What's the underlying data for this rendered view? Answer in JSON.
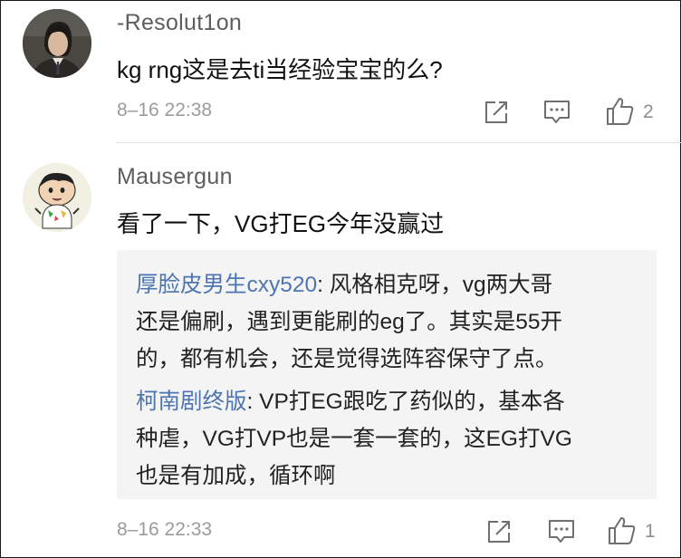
{
  "comments": [
    {
      "username": "-Resolut1on",
      "text": "kg rng这是去ti当经验宝宝的么?",
      "time": "8–16 22:38",
      "likes": "2",
      "avatar_icon": "person-photo-avatar"
    },
    {
      "username": "Mausergun",
      "text": "看了一下，VG打EG今年没赢过",
      "time": "8–16 22:33",
      "likes": "1",
      "avatar_icon": "cartoon-child-avatar",
      "replies": [
        {
          "author": "厚脸皮男生cxy520",
          "separator": ": ",
          "lines": [
            "风格相克呀，vg两大哥",
            "还是偏刷，遇到更能刷的eg了。其实是55开",
            "的，都有机会，还是觉得选阵容保守了点。"
          ]
        },
        {
          "author": "柯南剧终版",
          "separator": ": ",
          "lines": [
            "VP打EG跟吃了药似的，基本各",
            "种虐，VG打VP也是一套一套的，这EG打VG",
            "也是有加成，循环啊"
          ]
        }
      ]
    }
  ],
  "icons": {
    "share": "share-icon",
    "reply": "comment-icon",
    "like": "thumbs-up-icon"
  },
  "colors": {
    "username": "#5e5e5e",
    "reply_author": "#4e75b0",
    "timestamp": "#9b9b9b",
    "reply_background": "#f4f4f4"
  }
}
